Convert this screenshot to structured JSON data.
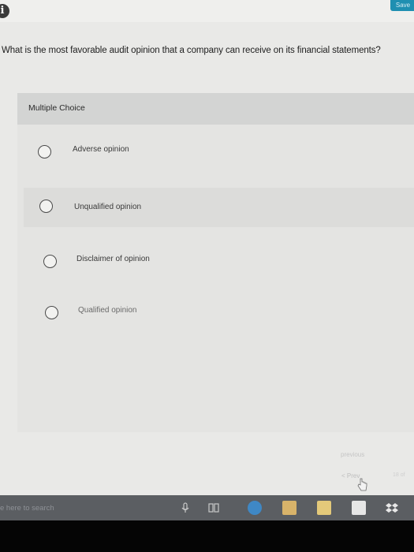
{
  "header": {
    "save_label": "Save",
    "info_glyph": "i"
  },
  "question": {
    "text": "What is the most favorable audit opinion that a company can receive on its financial statements?"
  },
  "panel": {
    "title": "Multiple Choice",
    "options": [
      {
        "label": "Adverse opinion"
      },
      {
        "label": "Unqualified opinion"
      },
      {
        "label": "Disclaimer of opinion"
      },
      {
        "label": "Qualified opinion"
      }
    ]
  },
  "navigation": {
    "previous_label": "previous",
    "prev_label": "< Prev",
    "page_label": "18 of"
  },
  "taskbar": {
    "search_placeholder": "e here to search",
    "icons": [
      "microphone-icon",
      "task-view-icon",
      "edge-icon",
      "file-explorer-icon",
      "store-icon",
      "amazon-icon",
      "dropbox-icon"
    ]
  },
  "colors": {
    "accent": "#1f8fb1",
    "panel_header": "#d3d4d3",
    "taskbar": "#5b5e62"
  }
}
